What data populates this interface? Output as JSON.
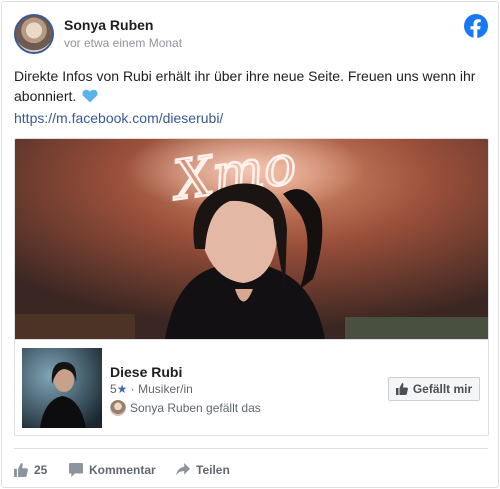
{
  "post": {
    "author": "Sonya Ruben",
    "time": "vor etwa einem Monat",
    "text": "Direkte Infos von Rubi erhält ihr über ihre neue Seite. Freuen uns wenn ihr abonniert.",
    "link": "https://m.facebook.com/dieserubi/"
  },
  "page_card": {
    "cover_art_text": "Xmo",
    "name": "Diese Rubi",
    "rating": "5",
    "category": "Musiker/in",
    "friend_like": "Sonya Ruben gefällt das",
    "like_button": "Gefällt mir"
  },
  "actions": {
    "like_count": "25",
    "comment_label": "Kommentar",
    "share_label": "Teilen"
  },
  "colors": {
    "facebook_blue": "#1877f2",
    "link_blue": "#385898",
    "heart": "#5ab4e8",
    "border": "#dddfe2",
    "muted_text": "#90949c"
  },
  "icons": [
    "facebook-logo-icon",
    "blue-heart-icon",
    "star-icon",
    "thumbs-up-icon",
    "comment-icon",
    "share-icon"
  ]
}
